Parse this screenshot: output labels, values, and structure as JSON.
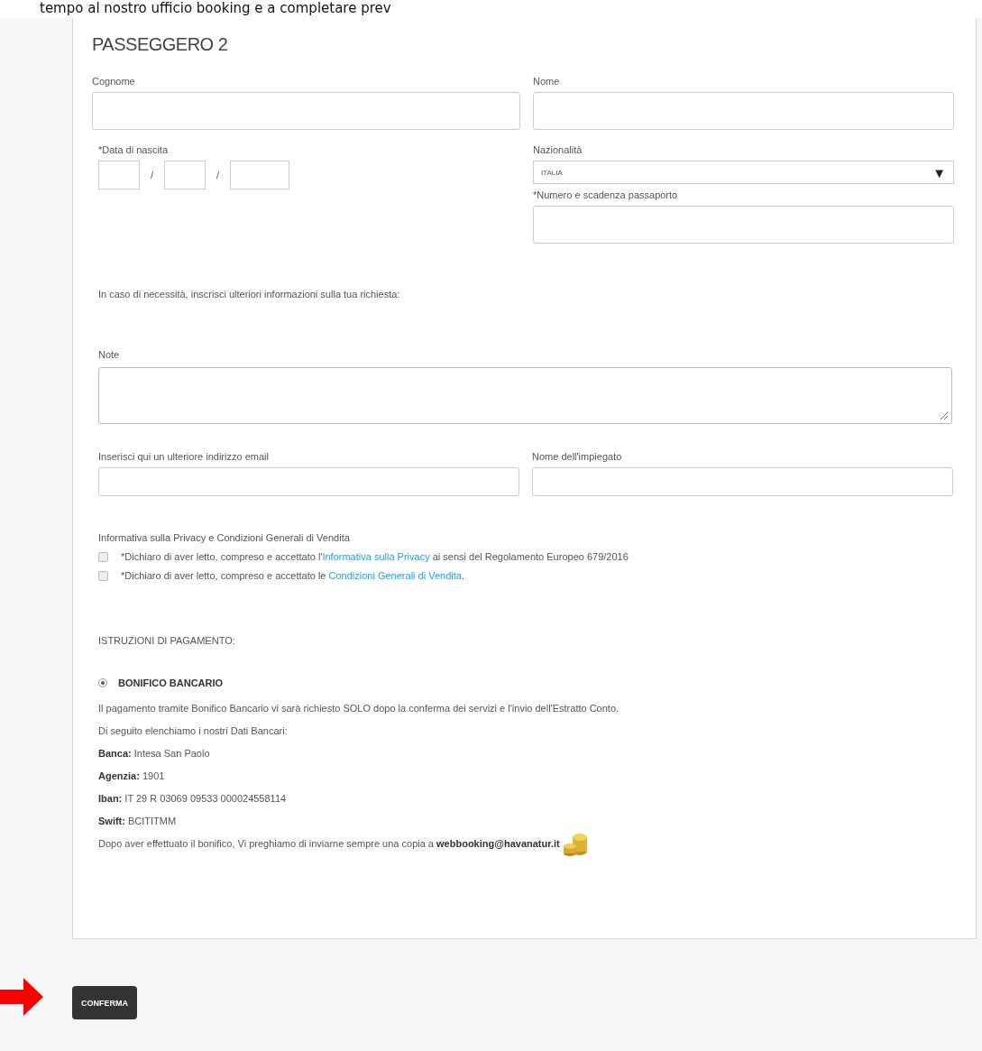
{
  "caption": "tempo al nostro ufficio booking e a completare prev",
  "passenger": {
    "title": "PASSEGGERO 2",
    "surname": {
      "label": "Cognome"
    },
    "name": {
      "label": "Nome"
    },
    "birth_date": {
      "label": "*Data di nascita",
      "separators": [
        "/",
        "/"
      ]
    },
    "nationality": {
      "label": "Nazionalità",
      "value": "ITALIA",
      "arrow": "▼"
    },
    "passport": {
      "label": "*Numero e scadenza passaporto"
    }
  },
  "notes_intro": "In caso di necessità, inscrisci ulteriori informazioni sulla tua richiesta:",
  "notes": {
    "label": "Note"
  },
  "extra_email": {
    "label": "Inserisci qui un ulteriore indirizzo email"
  },
  "employee": {
    "label": "Nome dell'impiegato"
  },
  "privacy": {
    "title": "Informativa sulla Privacy e Condizioni Generali di Vendita",
    "consents": [
      {
        "prefix": "*Dichiaro di aver letto, compreso e accettato l'",
        "link": "Informativa sulla Privacy",
        "suffix": " ai sensi del Regolamento Europeo 679/2016",
        "checked": false
      },
      {
        "prefix": "*Dichiaro di aver letto, compreso e accettato le ",
        "link": "Condizioni Generali di Vendita",
        "suffix": ".",
        "checked": false
      }
    ]
  },
  "payment": {
    "title": "ISTRUZIONI DI PAGAMENTO:",
    "method": {
      "label": "BONIFICO BANCARIO",
      "selected": true
    },
    "lines": [
      "Il pagamento tramite Bonifico Bancario vi sarà richiesto SOLO dopo la conferma dei servizi e l'invio dell'Estratto Conto.",
      "Di seguito elenchiamo i nostri Dati Bancari:",
      "**Banca:** Intesa San Paolo",
      "**Agenzia:** 1901",
      "**Iban:** IT 29 R 03069 09533 000024558114",
      "**Swift:** BCITITMM",
      "Dopo aver effettuato il bonifico, Vi preghiamo di inviarne sempre una copia a **webbooking@havanatur.it**"
    ]
  },
  "confirm_button": "CONFERMA"
}
